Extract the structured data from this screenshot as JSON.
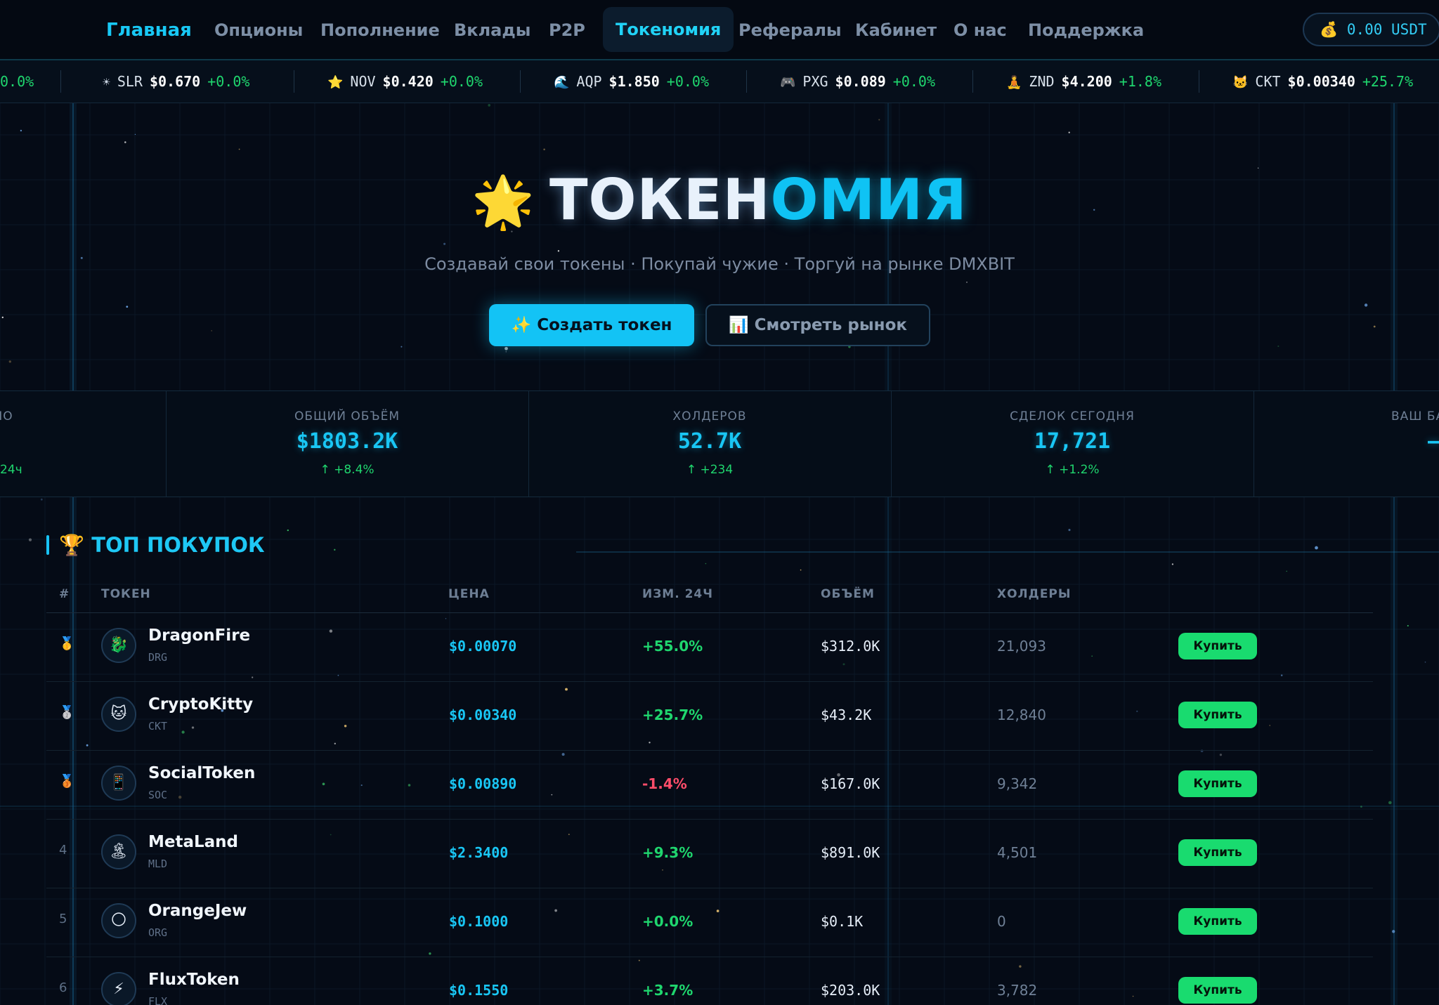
{
  "nav": {
    "items": [
      {
        "label": "Главная"
      },
      {
        "label": "Опционы"
      },
      {
        "label": "Пополнение"
      },
      {
        "label": "Вклады"
      },
      {
        "label": "P2P"
      },
      {
        "label": "Токеномия"
      },
      {
        "label": "Рефералы"
      },
      {
        "label": "Кабинет"
      },
      {
        "label": "О нас"
      },
      {
        "label": "Поддержка"
      }
    ],
    "active": "Токеномия",
    "balance": "0.00 USDT",
    "balance_icon": "money-bag-icon"
  },
  "ticker": [
    {
      "icon": "",
      "symbol": "",
      "price": "",
      "change": "0.0%"
    },
    {
      "icon": "☀",
      "symbol": "SLR",
      "price": "$0.670",
      "change": "+0.0%"
    },
    {
      "icon": "⭐",
      "symbol": "NOV",
      "price": "$0.420",
      "change": "+0.0%"
    },
    {
      "icon": "🌊",
      "symbol": "AQP",
      "price": "$1.850",
      "change": "+0.0%"
    },
    {
      "icon": "🎮",
      "symbol": "PXG",
      "price": "$0.089",
      "change": "+0.0%"
    },
    {
      "icon": "🧘",
      "symbol": "ZND",
      "price": "$4.200",
      "change": "+1.8%"
    },
    {
      "icon": "🐱",
      "symbol": "CKT",
      "price": "$0.00340",
      "change": "+25.7%"
    }
  ],
  "hero": {
    "icon": "🌟",
    "title_part1": "ТОКЕН",
    "title_part2": "ОМИЯ",
    "subtitle": "Создавай свои токены · Покупай чужие · Торгуй на рынке DMXBIT",
    "create_button": "✨ Создать токен",
    "market_button": "📊 Смотреть рынок"
  },
  "stats": [
    {
      "label": "ОЗДАНО",
      "value": "",
      "delta": "24ч"
    },
    {
      "label": "ОБЩИЙ ОБЪЁМ",
      "value": "$1803.2K",
      "delta": "↑ +8.4%"
    },
    {
      "label": "ХОЛДЕРОВ",
      "value": "52.7K",
      "delta": "↑ +234"
    },
    {
      "label": "СДЕЛОК СЕГОДНЯ",
      "value": "17,721",
      "delta": "↑ +1.2%"
    },
    {
      "label": "ВАШ БА",
      "value": "—",
      "delta": ""
    }
  ],
  "top": {
    "title": "🏆 ТОП ПОКУПОК",
    "columns": {
      "rank": "#",
      "token": "ТОКЕН",
      "price": "ЦЕНА",
      "change": "ИЗМ. 24Ч",
      "volume": "ОБЪЁМ",
      "holders": "ХОЛДЕРЫ"
    },
    "rows": [
      {
        "rank": "🥇",
        "icon": "🐉",
        "name": "DragonFire",
        "symbol": "DRG",
        "price": "$0.00070",
        "change": "+55.0%",
        "dir": "up",
        "volume": "$312.0K",
        "holders": "21,093",
        "buy": "Купить"
      },
      {
        "rank": "🥈",
        "icon": "🐱",
        "name": "CryptoKitty",
        "symbol": "CKT",
        "price": "$0.00340",
        "change": "+25.7%",
        "dir": "up",
        "volume": "$43.2K",
        "holders": "12,840",
        "buy": "Купить"
      },
      {
        "rank": "🥉",
        "icon": "📱",
        "name": "SocialToken",
        "symbol": "SOC",
        "price": "$0.00890",
        "change": "-1.4%",
        "dir": "down",
        "volume": "$167.0K",
        "holders": "9,342",
        "buy": "Купить"
      },
      {
        "rank": "4",
        "icon": "🏝",
        "name": "MetaLand",
        "symbol": "MLD",
        "price": "$2.3400",
        "change": "+9.3%",
        "dir": "up",
        "volume": "$891.0K",
        "holders": "4,501",
        "buy": "Купить"
      },
      {
        "rank": "5",
        "icon": "🌕",
        "name": "OrangeJew",
        "symbol": "ORG",
        "price": "$0.1000",
        "change": "+0.0%",
        "dir": "up",
        "volume": "$0.1K",
        "holders": "0",
        "buy": "Купить"
      },
      {
        "rank": "6",
        "icon": "⚡",
        "name": "FluxToken",
        "symbol": "FLX",
        "price": "$0.1550",
        "change": "+3.7%",
        "dir": "up",
        "volume": "$203.0K",
        "holders": "3,782",
        "buy": "Купить"
      }
    ]
  },
  "colors": {
    "accent": "#18c3f5",
    "up": "#1fd66e",
    "down": "#ff4d6a",
    "buy": "#19db6f",
    "background": "#050b16"
  }
}
